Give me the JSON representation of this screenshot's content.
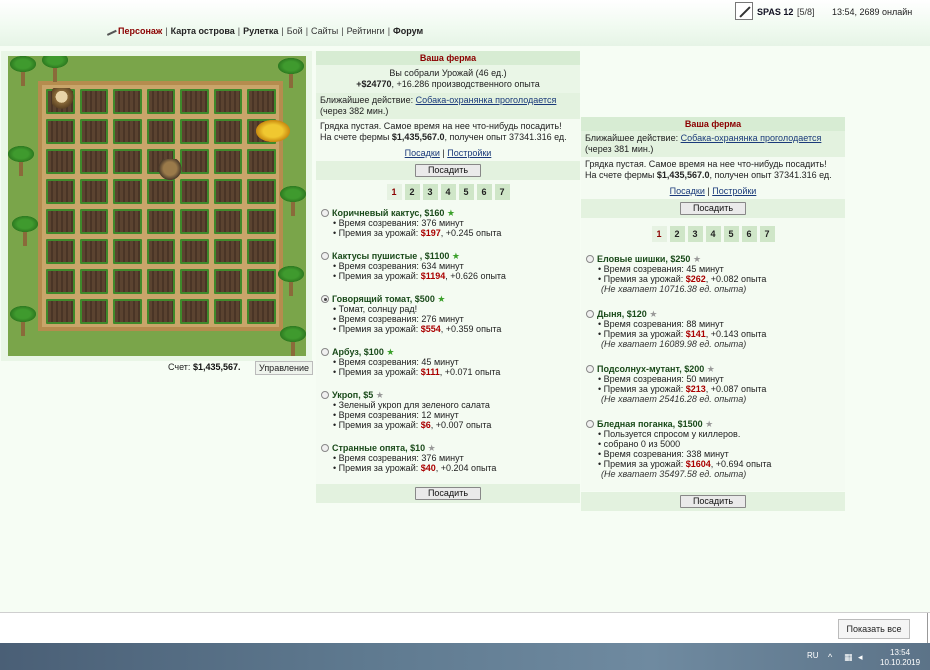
{
  "nav": {
    "items": [
      "Персонаж",
      "Карта острова",
      "Рулетка",
      "Бой",
      "Сайты",
      "Рейтинги",
      "Форум"
    ]
  },
  "user": {
    "name": "SPAS 12",
    "level": "[5/8]",
    "status": "13:54, 2689 онлайн"
  },
  "farm": {
    "account_label": "Счет:",
    "account_value": "$1,435,567.",
    "manage_button": "Управление"
  },
  "panel1": {
    "title": "Ваша ферма",
    "harvest_msg": "Вы собрали Урожай (46 ед.)",
    "harvest_money": "+$24770",
    "harvest_exp": ", +16.286 производственного опыта",
    "next_action_label": "Ближайшее действие:",
    "next_action_link": "Собака-охранянка проголодается",
    "next_action_time": "(через 382 мин.)",
    "empty_msg": "Грядка пустая. Самое время на нее что-нибудь посадить!",
    "balance_prefix": "На счете фермы",
    "balance_value": "$1,435,567.0",
    "balance_suffix": ", получен опыт 37341.316 ед.",
    "link_plant": "Посадки",
    "link_settings": "Постройки",
    "plant_button": "Посадить",
    "pages": [
      "1",
      "2",
      "3",
      "4",
      "5",
      "6",
      "7"
    ],
    "crops": [
      {
        "name": "Коричневый кактус, $160",
        "lines": [
          "Время созревания: 376 минут"
        ],
        "premium_prefix": "Премия за урожай:",
        "premium_money": "$197",
        "premium_exp": ", +0.245 опыта"
      },
      {
        "name": "Кактусы пушистые , $1100",
        "lines": [
          "Время созревания: 634 минут"
        ],
        "premium_prefix": "Премия за урожай:",
        "premium_money": "$1194",
        "premium_exp": ", +0.626 опыта"
      },
      {
        "name": "Говорящий томат, $500",
        "lines": [
          "Томат, солнцу рад!",
          "Время созревания: 276 минут"
        ],
        "premium_prefix": "Премия за урожай:",
        "premium_money": "$554",
        "premium_exp": ", +0.359 опыта"
      },
      {
        "name": "Арбуз, $100",
        "lines": [
          "Время созревания: 45 минут"
        ],
        "premium_prefix": "Премия за урожай:",
        "premium_money": "$111",
        "premium_exp": ", +0.071 опыта"
      },
      {
        "name": "Укроп, $5",
        "lines": [
          "Зеленый укроп для зеленого салата",
          "Время созревания: 12 минут"
        ],
        "premium_prefix": "Премия за урожай:",
        "premium_money": "$6",
        "premium_exp": ", +0.007 опыта"
      },
      {
        "name": "Странные опята, $10",
        "lines": [
          "Время созревания: 376 минут"
        ],
        "premium_prefix": "Премия за урожай:",
        "premium_money": "$40",
        "premium_exp": ", +0.204 опыта"
      }
    ]
  },
  "panel2": {
    "title": "Ваша ферма",
    "next_action_label": "Ближайшее действие:",
    "next_action_link": "Собака-охранянка проголодается",
    "next_action_time": "(через 381 мин.)",
    "empty_msg": "Грядка пустая. Самое время на нее что-нибудь посадить!",
    "balance_prefix": "На счете фермы",
    "balance_value": "$1,435,567.0",
    "balance_suffix": ", получен опыт 37341.316 ед.",
    "link_plant": "Посадки",
    "link_settings": "Постройки",
    "plant_button": "Посадить",
    "pages": [
      "1",
      "2",
      "3",
      "4",
      "5",
      "6",
      "7"
    ],
    "crops": [
      {
        "name": "Еловые шишки, $250",
        "lines": [
          "Время созревания: 45 минут"
        ],
        "premium_prefix": "Премия за урожай:",
        "premium_money": "$262",
        "premium_exp": ", +0.082 опыта",
        "shortage": "(Не хватает 10716.38 ед. опыта)"
      },
      {
        "name": "Дыня, $120",
        "lines": [
          "Время созревания: 88 минут"
        ],
        "premium_prefix": "Премия за урожай:",
        "premium_money": "$141",
        "premium_exp": ", +0.143 опыта",
        "shortage": "(Не хватает 16089.98 ед. опыта)"
      },
      {
        "name": "Подсолнух-мутант, $200",
        "lines": [
          "Время созревания: 50 минут"
        ],
        "premium_prefix": "Премия за урожай:",
        "premium_money": "$213",
        "premium_exp": ", +0.087 опыта",
        "shortage": "(Не хватает 25416.28 ед. опыта)"
      },
      {
        "name": "Бледная поганка, $1500",
        "lines": [
          "Пользуется спросом у киллеров.",
          "собрано 0 из 5000",
          "Время созревания: 338 минут"
        ],
        "premium_prefix": "Премия за урожай:",
        "premium_money": "$1604",
        "premium_exp": ", +0.694 опыта",
        "shortage": "(Не хватает 35497.58 ед. опыта)"
      }
    ]
  },
  "notify": {
    "show_all": "Показать все"
  },
  "tray": {
    "lang": "RU",
    "time": "13:54",
    "date": "10.10.2019"
  }
}
